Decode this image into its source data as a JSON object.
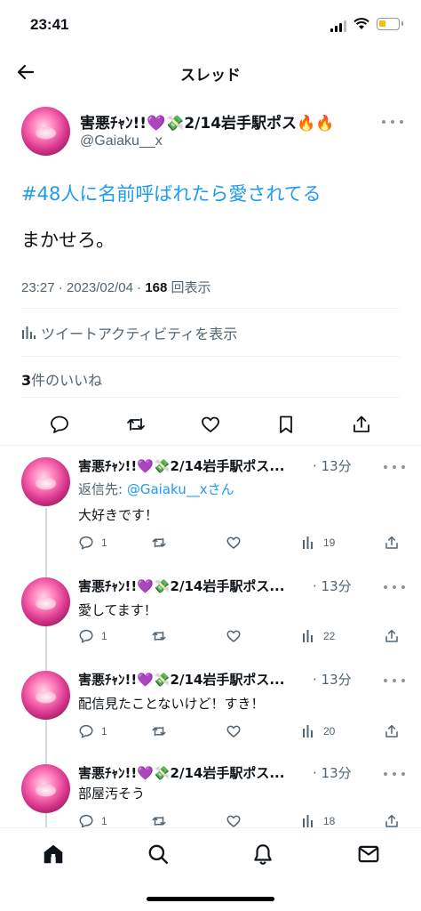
{
  "status": {
    "time": "23:41"
  },
  "nav": {
    "title": "スレッド"
  },
  "main_tweet": {
    "display_name": "害悪ﾁｬﾝ!!💜💸2/14岩手駅ポス🔥🔥",
    "handle": "@Gaiaku__x",
    "hashtag": "#48人に名前呼ばれたら愛されてる",
    "body": "まかせろ。",
    "time": "23:27",
    "date": "2023/02/04",
    "views": "168",
    "views_label": "回表示",
    "activity_label": "ツイートアクティビティを表示",
    "likes_count": "3",
    "likes_label": "件のいいね"
  },
  "replies": [
    {
      "display_name": "害悪ﾁｬﾝ!!💜💸2/14岩手駅ポス...",
      "time": "· 13分",
      "reply_to_prefix": "返信先: ",
      "reply_to_handle": "@Gaiaku__x",
      "reply_to_suffix": "さん",
      "text": "大好きです！",
      "replies": "1",
      "views": "19"
    },
    {
      "display_name": "害悪ﾁｬﾝ!!💜💸2/14岩手駅ポス...",
      "time": "· 13分",
      "text": "愛してます！",
      "replies": "1",
      "views": "22"
    },
    {
      "display_name": "害悪ﾁｬﾝ!!💜💸2/14岩手駅ポス...",
      "time": "· 13分",
      "text": "配信見たことないけど！すき！",
      "replies": "1",
      "views": "20"
    },
    {
      "display_name": "害悪ﾁｬﾝ!!💜💸2/14岩手駅ポス...",
      "time": "· 13分",
      "text": "部屋汚そう",
      "replies": "1",
      "views": "18"
    }
  ],
  "tabs": [
    {
      "icon": "home-icon"
    },
    {
      "icon": "search-icon"
    },
    {
      "icon": "bell-icon"
    },
    {
      "icon": "mail-icon"
    }
  ],
  "colors": {
    "accent": "#1d9bf0",
    "secondary_text": "#536471",
    "divider": "#eff3f4"
  }
}
